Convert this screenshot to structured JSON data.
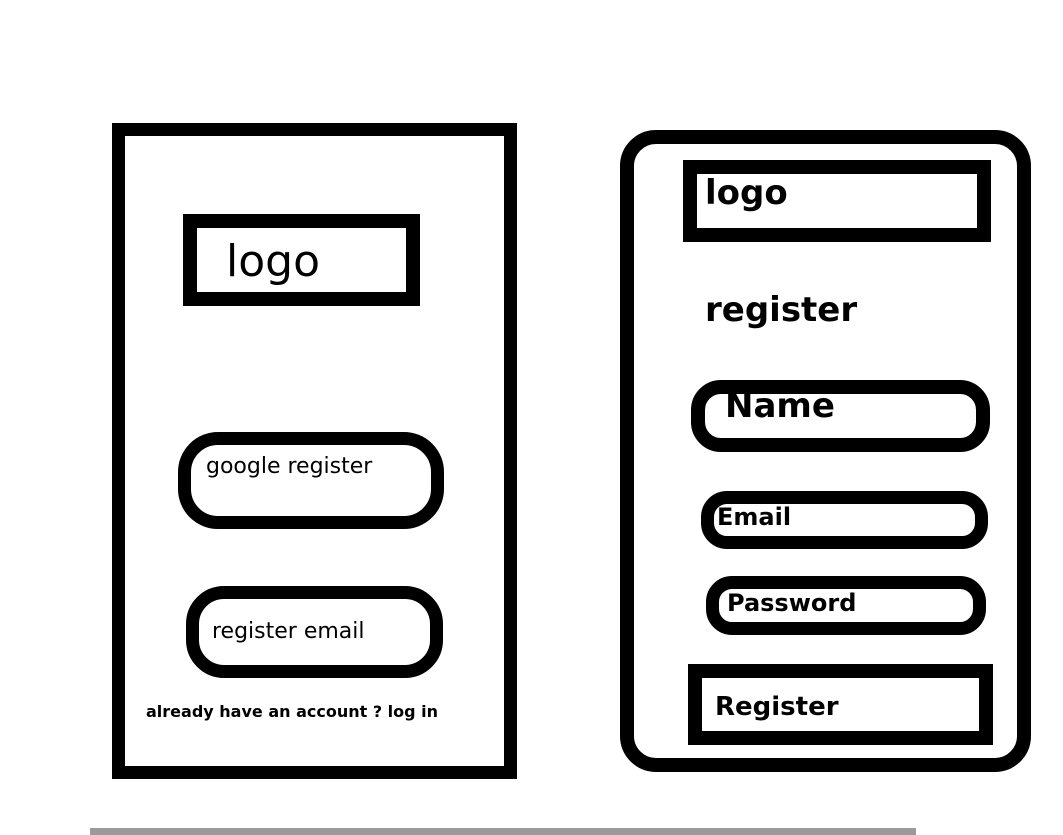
{
  "left_screen": {
    "logo_text": "logo",
    "google_register_label": "google register",
    "register_email_label": "register email",
    "login_prompt": "already have an account ? log in"
  },
  "right_screen": {
    "logo_text": "logo",
    "heading": "register",
    "name_field_label": "Name",
    "email_field_label": "Email",
    "password_field_label": "Password",
    "register_button_label": "Register"
  },
  "colors": {
    "stroke": "#000000",
    "background": "#ffffff",
    "divider": "#9a9a9a"
  }
}
